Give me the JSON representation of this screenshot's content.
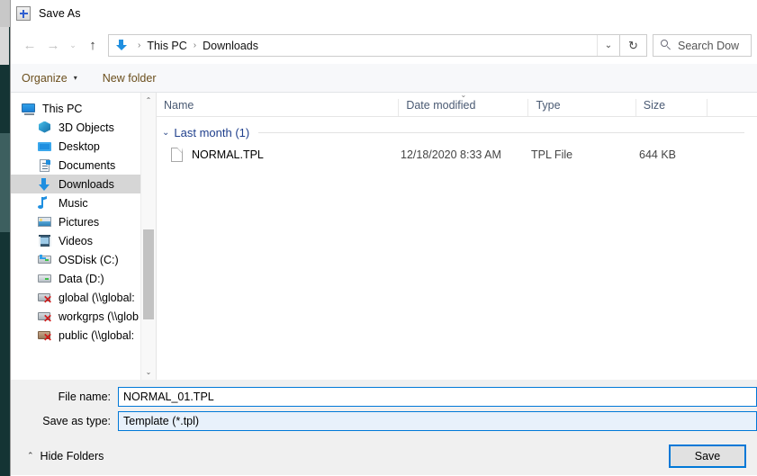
{
  "window": {
    "title": "Save As",
    "icon": "app-crosshair-icon"
  },
  "nav": {
    "back_icon": "←",
    "forward_icon": "→",
    "history_icon": "⌄",
    "up_icon": "↑",
    "refresh_icon": "↻",
    "address_dropdown_icon": "⌄"
  },
  "address": {
    "location_icon": "downloads-arrow-icon",
    "crumbs": [
      "This PC",
      "Downloads"
    ],
    "separator": "›"
  },
  "search": {
    "placeholder": "Search Dow",
    "icon": "search-icon"
  },
  "commandbar": {
    "organize_label": "Organize",
    "organize_caret": "▾",
    "new_folder_label": "New folder"
  },
  "tree": {
    "items": [
      {
        "label": "This PC",
        "icon": "monitor-icon",
        "indent": "root",
        "selected": false
      },
      {
        "label": "3D Objects",
        "icon": "cube-icon",
        "indent": "child",
        "selected": false
      },
      {
        "label": "Desktop",
        "icon": "desktop-icon",
        "indent": "child",
        "selected": false
      },
      {
        "label": "Documents",
        "icon": "document-icon",
        "indent": "child",
        "selected": false
      },
      {
        "label": "Downloads",
        "icon": "download-icon",
        "indent": "child",
        "selected": true
      },
      {
        "label": "Music",
        "icon": "music-icon",
        "indent": "child",
        "selected": false
      },
      {
        "label": "Pictures",
        "icon": "pictures-icon",
        "indent": "child",
        "selected": false
      },
      {
        "label": "Videos",
        "icon": "video-icon",
        "indent": "child",
        "selected": false
      },
      {
        "label": "OSDisk (C:)",
        "icon": "osdisk-icon",
        "indent": "child",
        "selected": false
      },
      {
        "label": "Data (D:)",
        "icon": "drive-icon",
        "indent": "child",
        "selected": false
      },
      {
        "label": "global (\\\\global:",
        "icon": "network-drive-disconnected-icon",
        "indent": "child",
        "selected": false
      },
      {
        "label": "workgrps (\\\\glob",
        "icon": "network-drive-disconnected-icon",
        "indent": "child",
        "selected": false
      },
      {
        "label": "public (\\\\global:",
        "icon": "network-drive-public-icon",
        "indent": "child",
        "selected": false
      }
    ],
    "scroll_up_icon": "⌃",
    "scroll_down_icon": "⌄"
  },
  "filelist": {
    "columns": [
      {
        "label": "Name",
        "sorted": false
      },
      {
        "label": "Date modified",
        "sorted": true
      },
      {
        "label": "Type",
        "sorted": false
      },
      {
        "label": "Size",
        "sorted": false
      }
    ],
    "sort_caret": "⌄",
    "group": {
      "caret": "⌄",
      "label": "Last month (1)"
    },
    "rows": [
      {
        "icon": "file-icon",
        "name": "NORMAL.TPL",
        "date_modified": "12/18/2020 8:33 AM",
        "type": "TPL File",
        "size": "644 KB"
      }
    ]
  },
  "form": {
    "filename_label": "File name:",
    "filename_value": "NORMAL_01.TPL",
    "savetype_label": "Save as type:",
    "savetype_value": "Template (*.tpl)"
  },
  "footer": {
    "hide_folders_caret": "⌃",
    "hide_folders_label": "Hide Folders",
    "save_label": "Save"
  },
  "colors": {
    "accent": "#0078d7",
    "group_header": "#1f3f8c",
    "column_header": "#4a5a73",
    "selection_grey": "#d6d6d6",
    "command_text": "#6b4f1d",
    "form_background": "#f0f0f0",
    "background_app": "#143434"
  }
}
